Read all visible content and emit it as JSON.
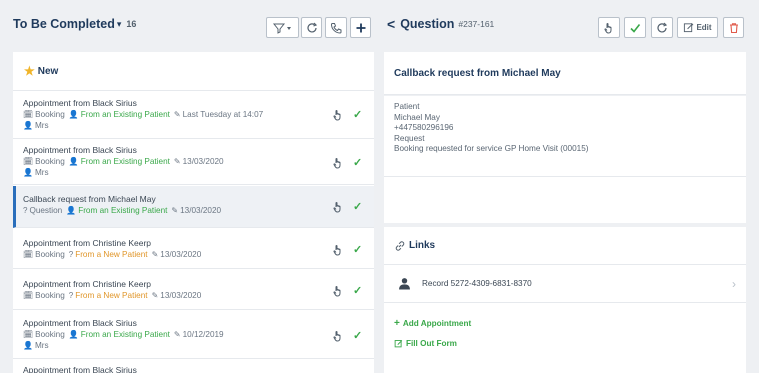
{
  "left_header": {
    "title": "To Be Completed",
    "caret": "▾",
    "count": "16"
  },
  "right_header": {
    "back": "<",
    "title": "Question",
    "code": "#237-161",
    "edit_label": "Edit"
  },
  "section": {
    "title": "New"
  },
  "rows": [
    {
      "title": "Appointment from Black Sirius",
      "type": "Booking",
      "source": "From an Existing Patient",
      "date": "Last Tuesday at 14:07",
      "extra": "Mrs"
    },
    {
      "title": "Appointment from Black Sirius",
      "type": "Booking",
      "source": "From an Existing Patient",
      "date": "13/03/2020",
      "extra": "Mrs"
    },
    {
      "title": "Callback request from Michael May",
      "type": "Question",
      "source": "From an Existing Patient",
      "date": "13/03/2020"
    },
    {
      "title": "Appointment from Christine Keerp",
      "type": "Booking",
      "source": "From a New Patient",
      "date": "13/03/2020"
    },
    {
      "title": "Appointment from Christine Keerp",
      "type": "Booking",
      "source": "From a New Patient",
      "date": "13/03/2020"
    },
    {
      "title": "Appointment from Black Sirius",
      "type": "Booking",
      "source": "From an Existing Patient",
      "date": "10/12/2019",
      "extra": "Mrs"
    },
    {
      "title": "Appointment from Black Sirius"
    }
  ],
  "detail": {
    "title": "Callback request from Michael May",
    "lines": [
      "Patient",
      "Michael May",
      "+447580296196",
      "Request",
      "Booking requested for service GP Home Visit (00015)"
    ]
  },
  "links": {
    "title": "Links",
    "record": "Record 5272-4309-6831-8370",
    "add_appointment": "Add Appointment",
    "fill_out_form": "Fill Out Form"
  },
  "colors": {
    "accent_green": "#3aa84a",
    "accent_orange": "#e0962a",
    "navy": "#1f3a5c",
    "danger": "#e05a4a",
    "selected_border": "#2a6ebb"
  }
}
